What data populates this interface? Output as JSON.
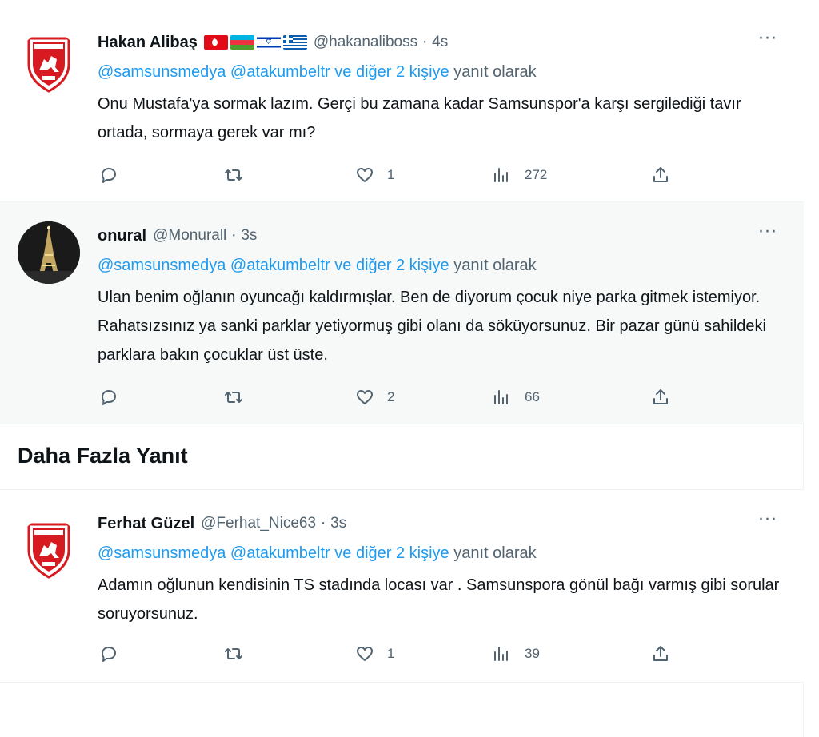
{
  "tweets": [
    {
      "name": "Hakan Alibaş",
      "handle": "@hakanaliboss",
      "time": "4s",
      "reply_mentions": "@samsunsmedya @atakumbeltr",
      "reply_others": "ve diğer 2 kişiye",
      "reply_suffix": "yanıt olarak",
      "text": "Onu Mustafa'ya sormak lazım. Gerçi bu zamana kadar Samsunspor'a karşı sergilediği tavır ortada, sormaya gerek var mı?",
      "likes": "1",
      "views": "272",
      "avatar": "samsunspor-logo",
      "flags": [
        "turkey-flag",
        "azerbaijan-flag",
        "israel-flag",
        "greece-flag"
      ]
    },
    {
      "name": "onural",
      "handle": "@Monurall",
      "time": "3s",
      "reply_mentions": "@samsunsmedya @atakumbeltr",
      "reply_others": "ve diğer 2 kişiye",
      "reply_suffix": "yanıt olarak",
      "text": "Ulan benim oğlanın oyuncağı kaldırmışlar. Ben de diyorum çocuk niye parka gitmek istemiyor. Rahatsızsınız ya sanki parklar yetiyormuş gibi olanı da söküyorsunuz. Bir pazar günü sahildeki parklara bakın çocuklar üst üste.",
      "likes": "2",
      "views": "66",
      "avatar": "eiffel-tower-night-photo"
    },
    {
      "name": "Ferhat Güzel",
      "handle": "@Ferhat_Nice63",
      "time": "3s",
      "reply_mentions": "@samsunsmedya @atakumbeltr",
      "reply_others": "ve diğer 2 kişiye",
      "reply_suffix": "yanıt olarak",
      "text": "Adamın oğlunun kendisinin TS stadında locası var  . Samsunspora gönül bağı varmış gibi sorular soruyorsunuz.",
      "likes": "1",
      "views": "39",
      "avatar": "samsunspor-logo"
    }
  ],
  "section_heading": "Daha Fazla Yanıt",
  "colors": {
    "accent": "#1d9bf0",
    "secondary_text": "#536471",
    "highlight_bg": "#f7f9f9",
    "logo_red": "#d71920"
  },
  "icons": [
    "reply-icon",
    "retweet-icon",
    "like-icon",
    "views-icon",
    "share-icon",
    "more-icon"
  ]
}
